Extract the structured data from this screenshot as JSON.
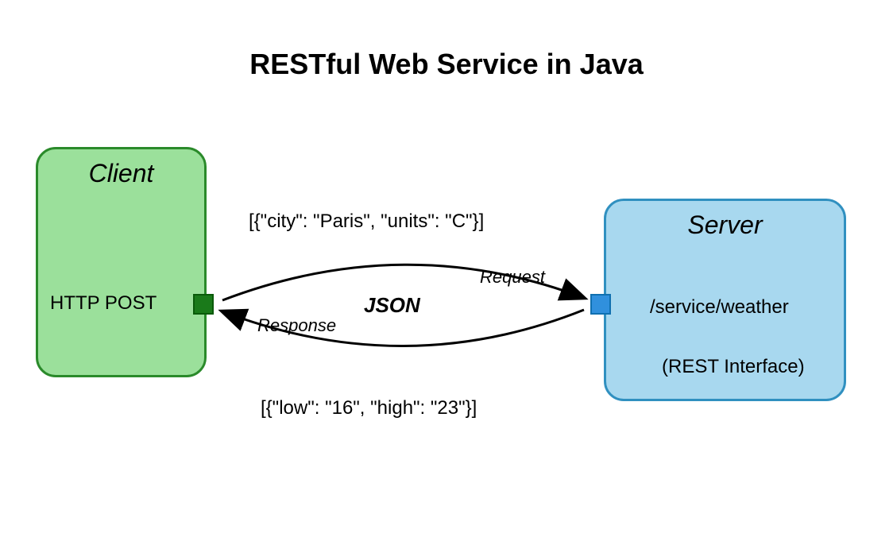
{
  "title": "RESTful Web Service in Java",
  "client": {
    "label": "Client",
    "protocol": "HTTP POST"
  },
  "server": {
    "label": "Server",
    "endpoint": "/service/weather",
    "interface": "(REST Interface)"
  },
  "exchange": {
    "request_payload": "[{\"city\": \"Paris\", \"units\": \"C\"}]",
    "request_label": "Request",
    "format": "JSON",
    "response_label": "Response",
    "response_payload": "[{\"low\": \"16\", \"high\": \"23\"}]"
  }
}
